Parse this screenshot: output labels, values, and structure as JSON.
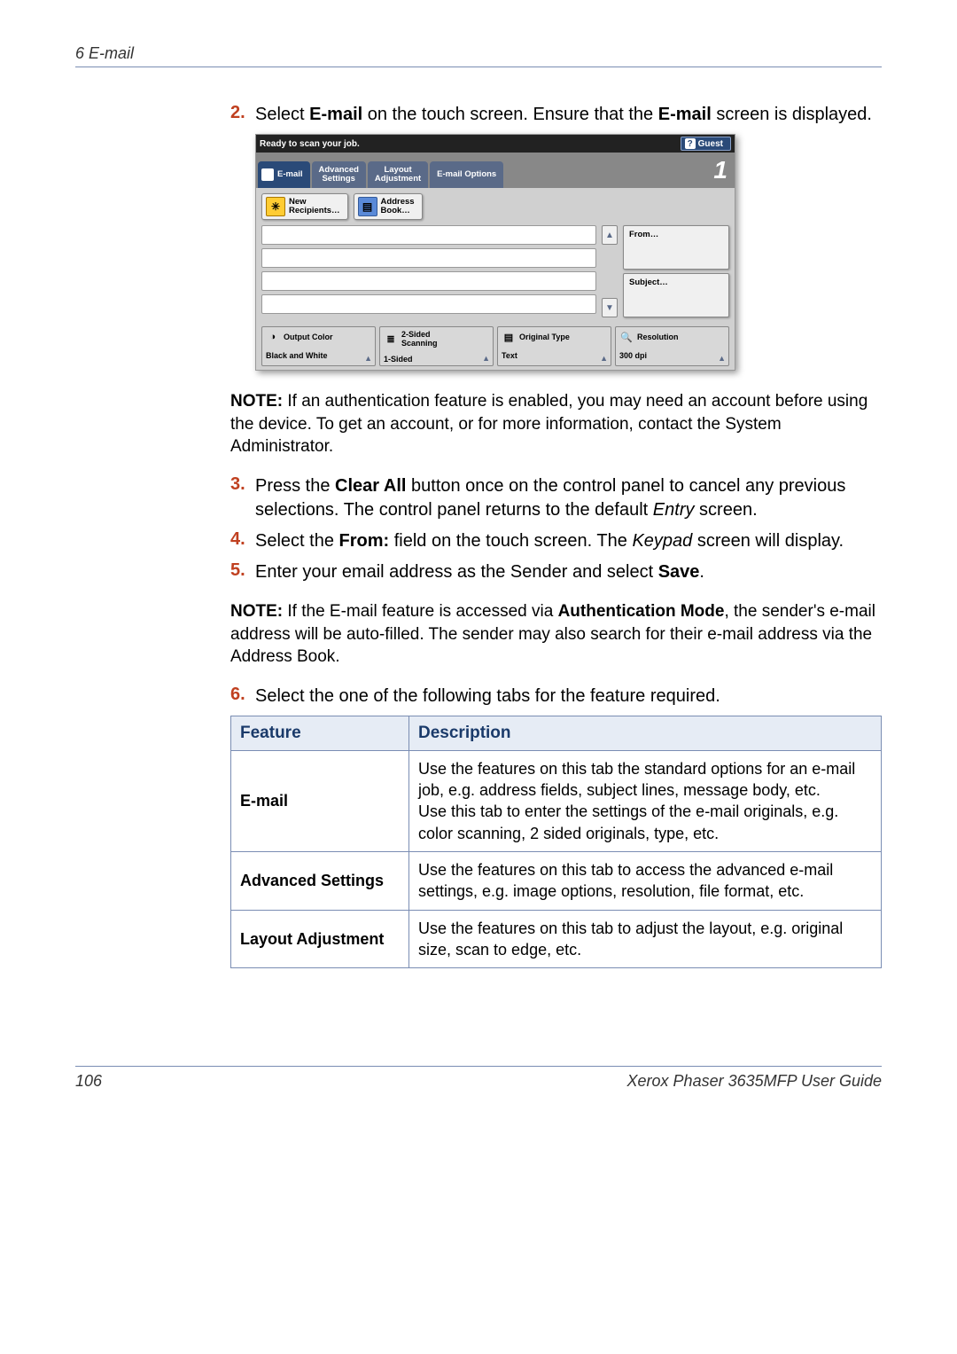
{
  "header": {
    "chapter": "6   E-mail"
  },
  "steps": {
    "s2": {
      "num": "2.",
      "pre": "Select ",
      "b1": "E-mail",
      "mid": " on the touch screen. Ensure that the ",
      "b2": "E-mail",
      "post": " screen is displayed."
    },
    "s3": {
      "num": "3.",
      "pre": "Press the ",
      "b1": "Clear All",
      "mid": " button once on the control panel to cancel any previous selections. The control panel returns to the default ",
      "i1": "Entry",
      "post": " screen."
    },
    "s4": {
      "num": "4.",
      "pre": "Select the ",
      "b1": "From:",
      "mid": " field on the touch screen. The ",
      "i1": "Keypad",
      "post": " screen will display."
    },
    "s5": {
      "num": "5.",
      "pre": "Enter your email address as the Sender and select ",
      "b1": "Save",
      "post": "."
    },
    "s6": {
      "num": "6.",
      "text": "Select the one of the following tabs for the feature required."
    }
  },
  "notes": {
    "n1": {
      "label": "NOTE:",
      "text": " If an authentication feature is enabled, you may need an account before using the device. To get an account, or for more information, contact the System Administrator."
    },
    "n2": {
      "label": "NOTE:",
      "pre": " If the E-mail feature is accessed via ",
      "b1": "Authentication Mode",
      "post": ", the sender's e-mail address will be auto-filled. The sender may also search for their e-mail address via the Address Book."
    }
  },
  "shot": {
    "title": "Ready to scan your job.",
    "guest": "Guest",
    "badge": "1",
    "tabs": {
      "t1": "E-mail",
      "t2": "Advanced\nSettings",
      "t3": "Layout\nAdjustment",
      "t4": "E-mail Options"
    },
    "toolbar": {
      "new_recipients": "New\nRecipients…",
      "address_book": "Address\nBook…"
    },
    "side": {
      "from": "From…",
      "subject": "Subject…"
    },
    "cards": {
      "output_color": {
        "title": "Output Color",
        "value": "Black and White"
      },
      "scanning": {
        "title": "2-Sided\nScanning",
        "value": "1-Sided"
      },
      "original": {
        "title": "Original Type",
        "value": "Text"
      },
      "resolution": {
        "title": "Resolution",
        "value": "300 dpi"
      }
    }
  },
  "table": {
    "h1": "Feature",
    "h2": "Description",
    "rows": [
      {
        "name": "E-mail",
        "desc": "Use the features on this tab the standard options for an e-mail job, e.g. address fields, subject lines, message body, etc.\nUse this tab to enter the settings of the e-mail originals, e.g. color scanning, 2 sided originals, type, etc."
      },
      {
        "name": "Advanced Settings",
        "desc": "Use the features on this tab to access the advanced e-mail settings, e.g. image options, resolution, file format, etc."
      },
      {
        "name": "Layout Adjustment",
        "desc": "Use the features on this tab to adjust the layout, e.g. original size, scan to edge, etc."
      }
    ]
  },
  "footer": {
    "page": "106",
    "guide": "Xerox Phaser 3635MFP User Guide"
  }
}
